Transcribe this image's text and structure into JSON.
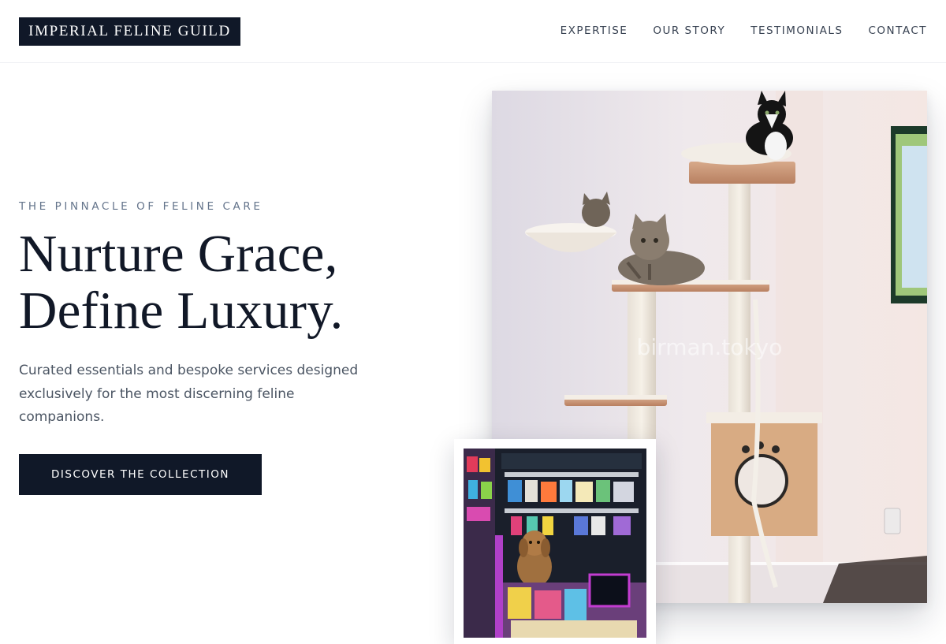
{
  "brand": {
    "name": "IMPERIAL FELINE GUILD"
  },
  "nav": {
    "items": [
      {
        "label": "EXPERTISE"
      },
      {
        "label": "OUR STORY"
      },
      {
        "label": "TESTIMONIALS"
      },
      {
        "label": "CONTACT"
      }
    ]
  },
  "hero": {
    "eyebrow": "THE PINNACLE OF FELINE CARE",
    "headline_line1": "Nurture Grace,",
    "headline_line2": "Define Luxury.",
    "lede": "Curated essentials and bespoke services designed exclusively for the most discerning feline companions.",
    "cta_label": "DISCOVER THE COLLECTION"
  },
  "images": {
    "main_watermark": "birman.tokyo"
  },
  "colors": {
    "primary_dark": "#101828",
    "text_muted": "#64748b",
    "body_text": "#4b5563"
  }
}
